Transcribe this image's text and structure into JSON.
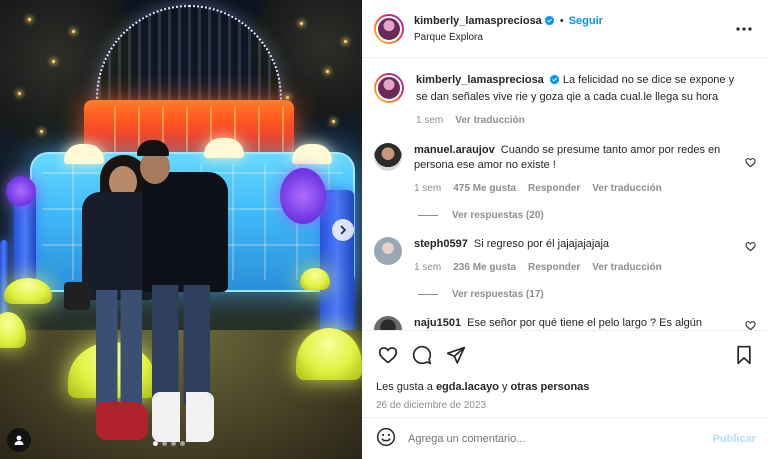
{
  "post": {
    "author": "kimberly_lamaspreciosa",
    "separator": "•",
    "follow_label": "Seguir",
    "location": "Parque Explora",
    "more_icon": "more-horizontal-icon"
  },
  "caption": {
    "username": "kimberly_lamaspreciosa",
    "text": "La felicidad no se dice se expone y se dan señales vive rie y goza qie a cada cual.le llega su hora",
    "time": "1 sem",
    "translate": "Ver traducción"
  },
  "comments": [
    {
      "username": "manuel.araujov",
      "text": "Cuando se presume tanto amor por redes en persona ese amor no existe !",
      "time": "1 sem",
      "likes": "475 Me gusta",
      "reply": "Responder",
      "translate": "Ver traducción",
      "view_replies": "Ver respuestas (20)"
    },
    {
      "username": "steph0597",
      "text": "Si regreso por él jajajajajaja",
      "time": "1 sem",
      "likes": "236 Me gusta",
      "reply": "Responder",
      "translate": "Ver traducción",
      "view_replies": "Ver respuestas (17)"
    },
    {
      "username": "naju1501",
      "text": "Ese señor por qué tiene el pelo largo ? Es algún"
    }
  ],
  "actions": {
    "likes_prefix": "Les gusta a ",
    "likes_user": "egda.lacayo",
    "likes_middle": " y ",
    "likes_others": "otras personas",
    "date": "26 de diciembre de 2023"
  },
  "add_comment": {
    "placeholder": "Agrega un comentario...",
    "publish_label": "Publicar"
  },
  "colors": {
    "accent": "#0095f6",
    "publish_disabled": "#b2dffc",
    "secondary_text": "#8e8e8e",
    "border": "#efefef"
  },
  "carousel": {
    "slides": 4,
    "active_slide": 1
  }
}
